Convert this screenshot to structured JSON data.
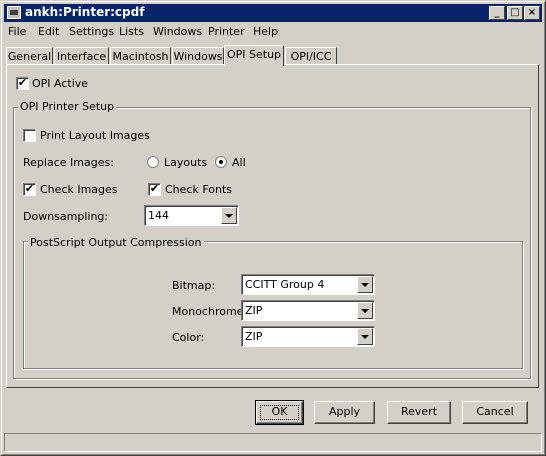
{
  "window": {
    "title": "ankh:Printer:cpdf",
    "min": "_",
    "max": "□",
    "close": "×"
  },
  "menu": [
    "File",
    "Edit",
    "Settings",
    "Lists",
    "Windows",
    "Printer",
    "Help"
  ],
  "tabs": [
    "General",
    "Interface",
    "Macintosh",
    "Windows",
    "OPI Setup",
    "OPI/ICC"
  ],
  "active_tab": "OPI Setup",
  "opi": {
    "active_label": "OPI Active",
    "active_checked": true,
    "group_title": "OPI Printer Setup",
    "print_layout_label": "Print Layout Images",
    "print_layout_checked": false,
    "replace_label": "Replace Images:",
    "replace_layouts": "Layouts",
    "replace_all": "All",
    "replace_selected": "All",
    "check_images_label": "Check Images",
    "check_images_checked": true,
    "check_fonts_label": "Check Fonts",
    "check_fonts_checked": true,
    "downsampling_label": "Downsampling:",
    "downsampling_value": "144",
    "compression_title": "PostScript Output Compression",
    "bitmap_label": "Bitmap:",
    "bitmap_value": "CCITT Group 4",
    "mono_label": "Monochrome:",
    "mono_value": "ZIP",
    "color_label": "Color:",
    "color_value": "ZIP"
  },
  "buttons": {
    "ok": "OK",
    "apply": "Apply",
    "revert": "Revert",
    "cancel": "Cancel"
  },
  "colors": {
    "titlebar": "#0a246a",
    "face": "#d4d0c8"
  }
}
